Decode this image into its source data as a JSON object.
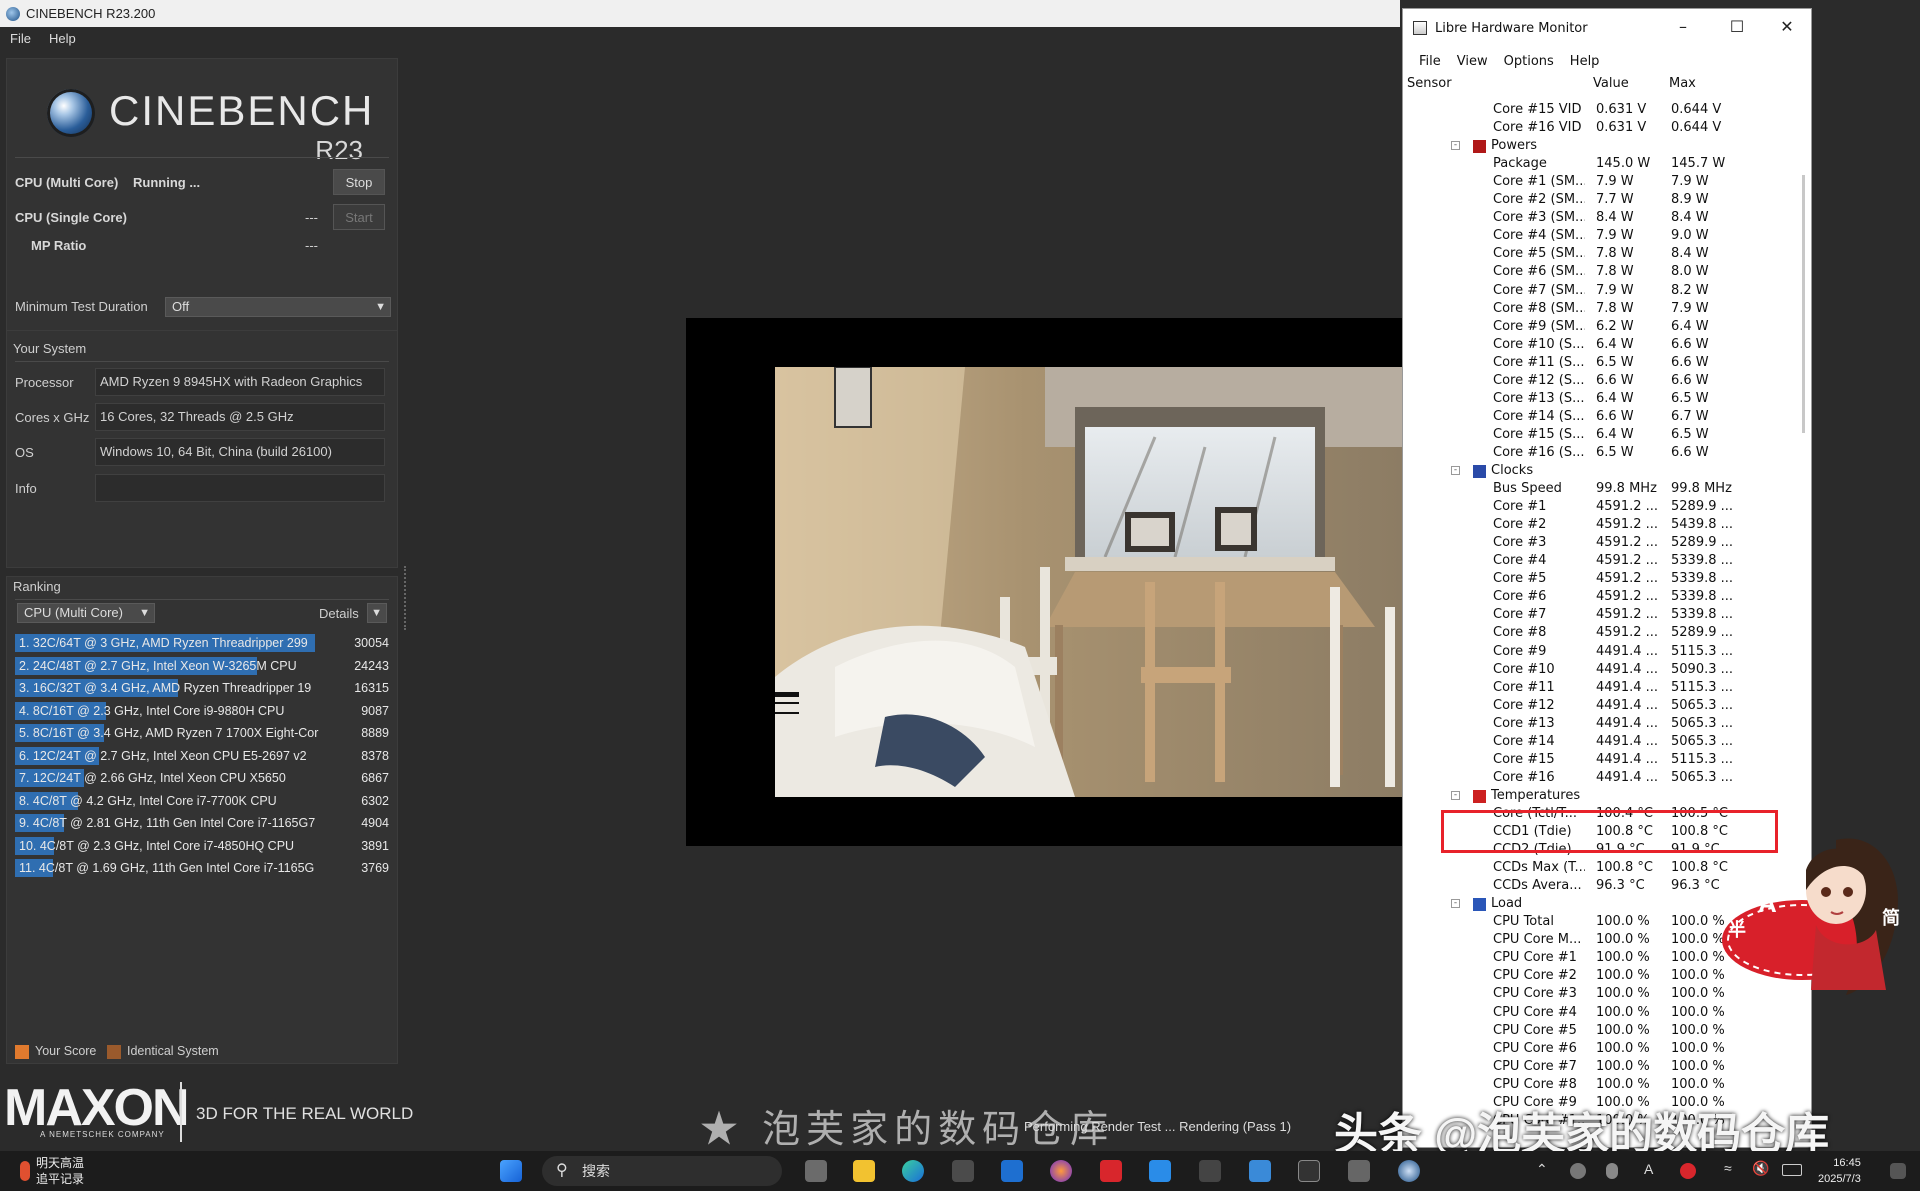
{
  "cinebench": {
    "window_title": "CINEBENCH R23.200",
    "menu": [
      "File",
      "Help"
    ],
    "logo_word": "CINEBENCH",
    "logo_version": "R23",
    "multi_core": {
      "label": "CPU (Multi Core)",
      "status": "Running ...",
      "button": "Stop"
    },
    "single_core": {
      "label": "CPU (Single Core)",
      "status": "---",
      "button": "Start"
    },
    "mp_ratio": {
      "label": "MP Ratio",
      "value": "---"
    },
    "min_duration": {
      "label": "Minimum Test Duration",
      "value": "Off"
    },
    "your_system": {
      "title": "Your System",
      "rows": [
        {
          "label": "Processor",
          "value": "AMD Ryzen 9 8945HX with Radeon Graphics"
        },
        {
          "label": "Cores x GHz",
          "value": "16 Cores, 32 Threads @ 2.5 GHz"
        },
        {
          "label": "OS",
          "value": "Windows 10, 64 Bit, China (build 26100)"
        },
        {
          "label": "Info",
          "value": ""
        }
      ]
    },
    "ranking": {
      "title": "Ranking",
      "mode": "CPU (Multi Core)",
      "details": "Details",
      "max_score": 30054,
      "items": [
        {
          "text": "1. 32C/64T @ 3 GHz, AMD Ryzen Threadripper 299",
          "score": 30054
        },
        {
          "text": "2. 24C/48T @ 2.7 GHz, Intel Xeon W-3265M CPU",
          "score": 24243
        },
        {
          "text": "3. 16C/32T @ 3.4 GHz, AMD Ryzen Threadripper 19",
          "score": 16315
        },
        {
          "text": "4. 8C/16T @ 2.3 GHz, Intel Core i9-9880H CPU",
          "score": 9087
        },
        {
          "text": "5. 8C/16T @ 3.4 GHz, AMD Ryzen 7 1700X Eight-Cor",
          "score": 8889
        },
        {
          "text": "6. 12C/24T @ 2.7 GHz, Intel Xeon CPU E5-2697 v2",
          "score": 8378
        },
        {
          "text": "7. 12C/24T @ 2.66 GHz, Intel Xeon CPU X5650",
          "score": 6867
        },
        {
          "text": "8. 4C/8T @ 4.2 GHz, Intel Core i7-7700K CPU",
          "score": 6302
        },
        {
          "text": "9. 4C/8T @ 2.81 GHz, 11th Gen Intel Core i7-1165G7",
          "score": 4904
        },
        {
          "text": "10. 4C/8T @ 2.3 GHz, Intel Core i7-4850HQ CPU",
          "score": 3891
        },
        {
          "text": "11. 4C/8T @ 1.69 GHz, 11th Gen Intel Core i7-1165G",
          "score": 3769
        }
      ]
    },
    "legend": {
      "your_score": "Your Score",
      "identical": "Identical System"
    },
    "maxon": {
      "word": "MAXON",
      "sub": "A NEMETSCHEK COMPANY",
      "tagline": "3D FOR THE REAL WORLD"
    },
    "render_status": "Performing Render Test ... Rendering (Pass 1)",
    "colors": {
      "bar": "#2f6eb1",
      "your_score": "#e07a2e",
      "identical": "#9a5a2c"
    }
  },
  "lhm": {
    "title": "Libre Hardware Monitor",
    "menu": [
      "File",
      "View",
      "Options",
      "Help"
    ],
    "headers": {
      "sensor": "Sensor",
      "value": "Value",
      "max": "Max"
    },
    "rows": [
      {
        "name": "Core #15 VID",
        "value": "0.631 V",
        "max": "0.644 V"
      },
      {
        "name": "Core #16 VID",
        "value": "0.631 V",
        "max": "0.644 V"
      },
      {
        "group": "Powers",
        "icon": "power"
      },
      {
        "name": "Package",
        "value": "145.0 W",
        "max": "145.7 W"
      },
      {
        "name": "Core #1 (SM...",
        "value": "7.9 W",
        "max": "7.9 W"
      },
      {
        "name": "Core #2 (SM...",
        "value": "7.7 W",
        "max": "8.9 W"
      },
      {
        "name": "Core #3 (SM...",
        "value": "8.4 W",
        "max": "8.4 W"
      },
      {
        "name": "Core #4 (SM...",
        "value": "7.9 W",
        "max": "9.0 W"
      },
      {
        "name": "Core #5 (SM...",
        "value": "7.8 W",
        "max": "8.4 W"
      },
      {
        "name": "Core #6 (SM...",
        "value": "7.8 W",
        "max": "8.0 W"
      },
      {
        "name": "Core #7 (SM...",
        "value": "7.9 W",
        "max": "8.2 W"
      },
      {
        "name": "Core #8 (SM...",
        "value": "7.8 W",
        "max": "7.9 W"
      },
      {
        "name": "Core #9 (SM...",
        "value": "6.2 W",
        "max": "6.4 W"
      },
      {
        "name": "Core #10 (S...",
        "value": "6.4 W",
        "max": "6.6 W"
      },
      {
        "name": "Core #11 (S...",
        "value": "6.5 W",
        "max": "6.6 W"
      },
      {
        "name": "Core #12 (S...",
        "value": "6.6 W",
        "max": "6.6 W"
      },
      {
        "name": "Core #13 (S...",
        "value": "6.4 W",
        "max": "6.5 W"
      },
      {
        "name": "Core #14 (S...",
        "value": "6.6 W",
        "max": "6.7 W"
      },
      {
        "name": "Core #15 (S...",
        "value": "6.4 W",
        "max": "6.5 W"
      },
      {
        "name": "Core #16 (S...",
        "value": "6.5 W",
        "max": "6.6 W"
      },
      {
        "group": "Clocks",
        "icon": "clock"
      },
      {
        "name": "Bus Speed",
        "value": "99.8 MHz",
        "max": "99.8 MHz"
      },
      {
        "name": "Core #1",
        "value": "4591.2 ...",
        "max": "5289.9 ..."
      },
      {
        "name": "Core #2",
        "value": "4591.2 ...",
        "max": "5439.8 ..."
      },
      {
        "name": "Core #3",
        "value": "4591.2 ...",
        "max": "5289.9 ..."
      },
      {
        "name": "Core #4",
        "value": "4591.2 ...",
        "max": "5339.8 ..."
      },
      {
        "name": "Core #5",
        "value": "4591.2 ...",
        "max": "5339.8 ..."
      },
      {
        "name": "Core #6",
        "value": "4591.2 ...",
        "max": "5339.8 ..."
      },
      {
        "name": "Core #7",
        "value": "4591.2 ...",
        "max": "5339.8 ..."
      },
      {
        "name": "Core #8",
        "value": "4591.2 ...",
        "max": "5289.9 ..."
      },
      {
        "name": "Core #9",
        "value": "4491.4 ...",
        "max": "5115.3 ..."
      },
      {
        "name": "Core #10",
        "value": "4491.4 ...",
        "max": "5090.3 ..."
      },
      {
        "name": "Core #11",
        "value": "4491.4 ...",
        "max": "5115.3 ..."
      },
      {
        "name": "Core #12",
        "value": "4491.4 ...",
        "max": "5065.3 ..."
      },
      {
        "name": "Core #13",
        "value": "4491.4 ...",
        "max": "5065.3 ..."
      },
      {
        "name": "Core #14",
        "value": "4491.4 ...",
        "max": "5065.3 ..."
      },
      {
        "name": "Core #15",
        "value": "4491.4 ...",
        "max": "5115.3 ..."
      },
      {
        "name": "Core #16",
        "value": "4491.4 ...",
        "max": "5065.3 ..."
      },
      {
        "group": "Temperatures",
        "icon": "temp"
      },
      {
        "name": "Core (Tctl/T...",
        "value": "100.4 °C",
        "max": "100.5 °C"
      },
      {
        "name": "CCD1 (Tdie)",
        "value": "100.8 °C",
        "max": "100.8 °C"
      },
      {
        "name": "CCD2 (Tdie)",
        "value": "91.9 °C",
        "max": "91.9 °C"
      },
      {
        "name": "CCDs Max (T...",
        "value": "100.8 °C",
        "max": "100.8 °C"
      },
      {
        "name": "CCDs Avera...",
        "value": "96.3 °C",
        "max": "96.3 °C"
      },
      {
        "group": "Load",
        "icon": "load"
      },
      {
        "name": "CPU Total",
        "value": "100.0 %",
        "max": "100.0 %"
      },
      {
        "name": "CPU Core M...",
        "value": "100.0 %",
        "max": "100.0 %"
      },
      {
        "name": "CPU Core #1",
        "value": "100.0 %",
        "max": "100.0 %"
      },
      {
        "name": "CPU Core #2",
        "value": "100.0 %",
        "max": "100.0 %"
      },
      {
        "name": "CPU Core #3",
        "value": "100.0 %",
        "max": "100.0 %"
      },
      {
        "name": "CPU Core #4",
        "value": "100.0 %",
        "max": "100.0 %"
      },
      {
        "name": "CPU Core #5",
        "value": "100.0 %",
        "max": "100.0 %"
      },
      {
        "name": "CPU Core #6",
        "value": "100.0 %",
        "max": "100.0 %"
      },
      {
        "name": "CPU Core #7",
        "value": "100.0 %",
        "max": "100.0 %"
      },
      {
        "name": "CPU Core #8",
        "value": "100.0 %",
        "max": "100.0 %"
      },
      {
        "name": "CPU Core #9",
        "value": "100.0 %",
        "max": "100.0 %"
      },
      {
        "name": "CPU Core #1...",
        "value": "100.0 %",
        "max": "100.0 %"
      }
    ],
    "highlight_color": "#e8222a"
  },
  "watermarks": {
    "left": "★ 泡芙家的数码仓库",
    "right": "头条 @泡芙家的数码仓库",
    "sticker_text": "A",
    "sticker_left": "半",
    "sticker_right": "简"
  },
  "taskbar": {
    "weather_line1": "明天高温",
    "weather_line2": "追平记录",
    "search_placeholder": "搜索",
    "time": "16:45",
    "date": "2025/7/3"
  }
}
